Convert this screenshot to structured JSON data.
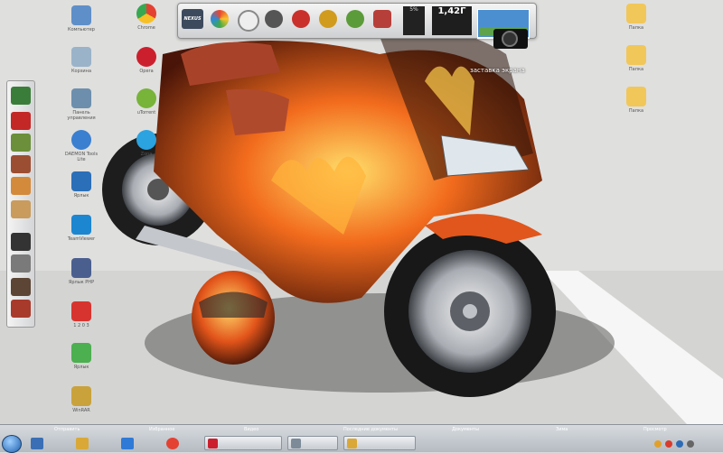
{
  "top_dock": {
    "cpu": "5%",
    "memory": "1,42Г"
  },
  "gadget": {
    "caption": "заставка экрана"
  },
  "taskbar": {
    "labels": [
      "Отправить",
      "Избранное",
      "Видео",
      "Последние документы",
      "Документы",
      "Зима",
      "Просмотр"
    ]
  },
  "desktop": {
    "icons": [
      {
        "name": "computer",
        "label": "Компьютер",
        "color": "#5f8fc8"
      },
      {
        "name": "recycle-bin",
        "label": "Корзина",
        "color": "#9ab3c9"
      },
      {
        "name": "network",
        "label": "Панель управления",
        "color": "#6d8fad"
      },
      {
        "name": "daemon-tools",
        "label": "DAEMON Tools Lite",
        "color": "#3a7fd0"
      },
      {
        "name": "monitor",
        "label": "Ярлык",
        "color": "#2b6fb8"
      },
      {
        "name": "teamviewer",
        "label": "TeamViewer",
        "color": "#1c86d1"
      },
      {
        "name": "php",
        "label": "Ярлык PHP",
        "color": "#4b5f8f"
      },
      {
        "name": "tool-red",
        "label": "1 2 0 3",
        "color": "#d8342f"
      },
      {
        "name": "app-green",
        "label": "Ярлык",
        "color": "#4caf50"
      },
      {
        "name": "winrar",
        "label": "WinRAR",
        "color": "#c9a23b"
      },
      {
        "name": "chrome",
        "label": "Chrome",
        "color": "#e44133"
      },
      {
        "name": "opera",
        "label": "Opera",
        "color": "#cc1f2d"
      },
      {
        "name": "utorrent",
        "label": "uTorrent",
        "color": "#78b33a"
      },
      {
        "name": "zona",
        "label": "Zona",
        "color": "#2aa3e0"
      },
      {
        "name": "folder-1",
        "label": "Папка",
        "color": "#f1c75a"
      },
      {
        "name": "folder-2",
        "label": "Папка",
        "color": "#f1c75a"
      },
      {
        "name": "folder-3",
        "label": "Папка",
        "color": "#f1c75a"
      }
    ]
  }
}
